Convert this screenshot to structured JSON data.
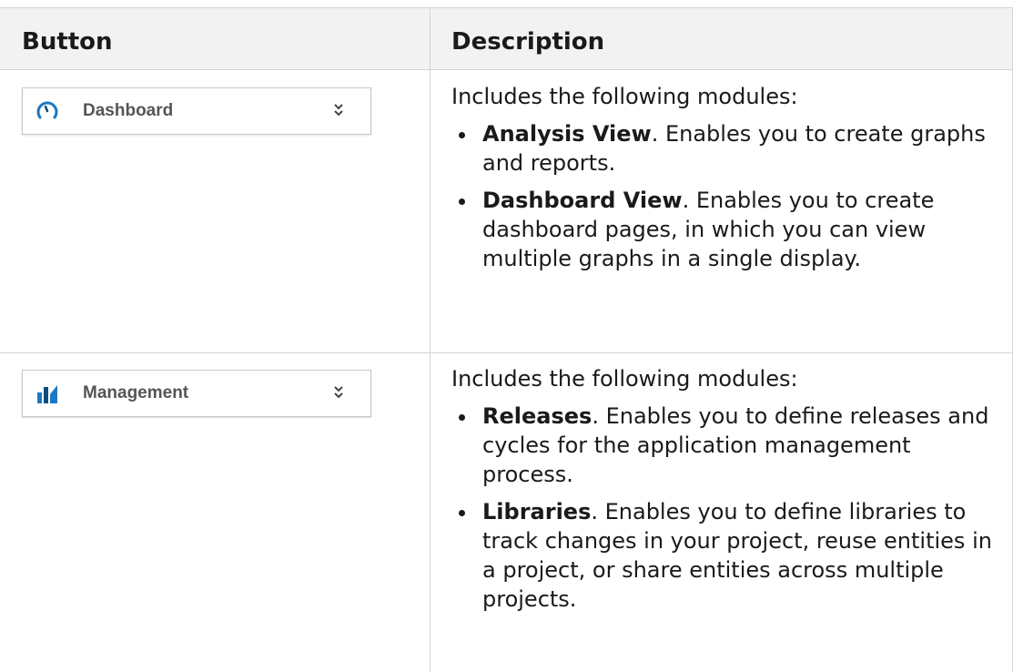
{
  "table": {
    "headers": {
      "button": "Button",
      "description": "Description"
    },
    "rows": [
      {
        "widget": {
          "label": "Dashboard",
          "icon": "dashboard-gauge-icon",
          "chevron": "double-chevron-down-icon"
        },
        "intro": "Includes the following modules:",
        "items": [
          {
            "term": "Analysis View",
            "text": ". Enables you to create graphs and reports."
          },
          {
            "term": "Dashboard View",
            "text": ". Enables you to create dashboard pages, in which you can view multiple graphs in a single display."
          }
        ]
      },
      {
        "widget": {
          "label": "Management",
          "icon": "management-bar-chart-icon",
          "chevron": "double-chevron-down-icon"
        },
        "intro": "Includes the following modules:",
        "items": [
          {
            "term": "Releases",
            "text": ". Enables you to define releases and cycles for the application management process."
          },
          {
            "term": "Libraries",
            "text": ". Enables you to define libraries to track changes in your project, reuse entities in a project, or share entities across multiple projects."
          }
        ]
      }
    ]
  },
  "colors": {
    "header_bg": "#f2f2f2",
    "grid": "#d4d4d4",
    "icon_blue": "#1b78c2",
    "icon_dark": "#0e4d7a"
  }
}
